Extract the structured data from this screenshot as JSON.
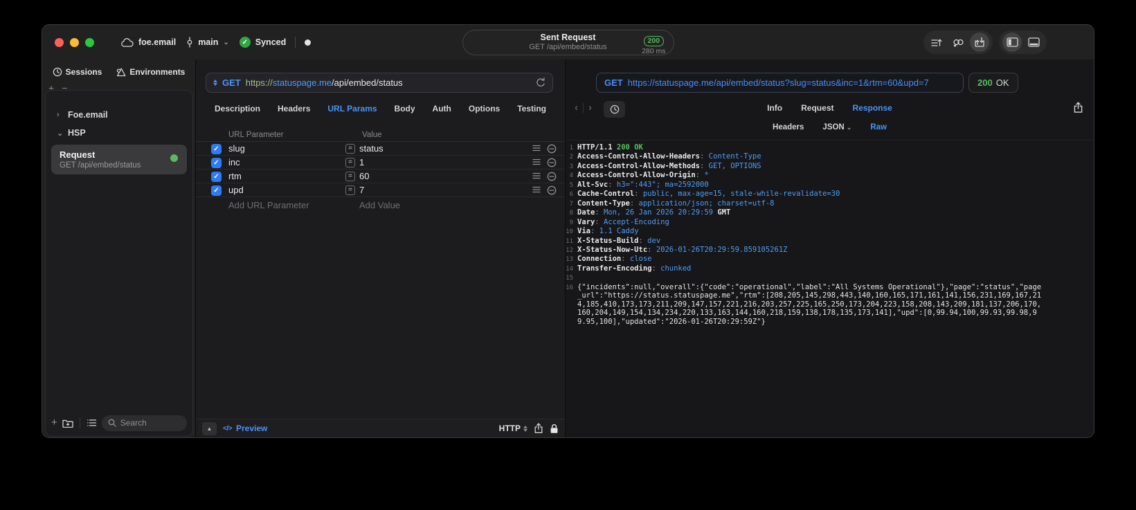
{
  "titlebar": {
    "project": "foe.email",
    "branch": "main",
    "sync_label": "Synced",
    "center": {
      "title": "Sent Request",
      "subtitle": "GET /api/embed/status",
      "status_code": "200",
      "duration": "280 ms"
    }
  },
  "sidebar": {
    "tabs": [
      {
        "label": "Sessions"
      },
      {
        "label": "Environments"
      }
    ],
    "tree": [
      {
        "label": "Foe.email"
      },
      {
        "label": "HSP"
      }
    ],
    "request_item": {
      "title": "Request",
      "subtitle": "GET /api/embed/status"
    },
    "search_placeholder": "Search"
  },
  "request_pane": {
    "method": "GET",
    "url": {
      "scheme": "https://",
      "host": "statuspage.me",
      "path": "/api/embed/status"
    },
    "tabs": [
      "Description",
      "Headers",
      "URL Params",
      "Body",
      "Auth",
      "Options",
      "Testing"
    ],
    "active_tab": "URL Params",
    "params": {
      "columns": [
        "URL Parameter",
        "Value"
      ],
      "rows": [
        {
          "name": "slug",
          "value": "status",
          "checked": true
        },
        {
          "name": "inc",
          "value": "1",
          "checked": true
        },
        {
          "name": "rtm",
          "value": "60",
          "checked": true
        },
        {
          "name": "upd",
          "value": "7",
          "checked": true
        }
      ],
      "add_name": "Add URL Parameter",
      "add_value": "Add Value"
    },
    "footer": {
      "preview": "Preview",
      "protocol": "HTTP"
    }
  },
  "response_pane": {
    "request_line": {
      "method": "GET",
      "url": "https://statuspage.me/api/embed/status?slug=status&inc=1&rtm=60&upd=7"
    },
    "status": {
      "code": "200",
      "text": "OK"
    },
    "tabs": [
      "Info",
      "Request",
      "Response"
    ],
    "active_tab": "Response",
    "view_tabs": [
      "Headers",
      "JSON",
      "Raw"
    ],
    "active_view": "Raw",
    "body_lines": [
      {
        "n": "1",
        "parts": [
          [
            "HTTP/1.1 ",
            "n"
          ],
          [
            "200 OK",
            "g"
          ]
        ]
      },
      {
        "n": "2",
        "parts": [
          [
            "Access-Control-Allow-Headers",
            "n"
          ],
          [
            ": ",
            "p"
          ],
          [
            "Content-Type",
            "v"
          ]
        ]
      },
      {
        "n": "3",
        "parts": [
          [
            "Access-Control-Allow-Methods",
            "n"
          ],
          [
            ": ",
            "p"
          ],
          [
            "GET, OPTIONS",
            "v"
          ]
        ]
      },
      {
        "n": "4",
        "parts": [
          [
            "Access-Control-Allow-Origin",
            "n"
          ],
          [
            ": ",
            "p"
          ],
          [
            "*",
            "v"
          ]
        ]
      },
      {
        "n": "5",
        "parts": [
          [
            "Alt-Svc",
            "n"
          ],
          [
            ": ",
            "p"
          ],
          [
            "h3=\":443\"; ma=2592000",
            "v"
          ]
        ]
      },
      {
        "n": "6",
        "parts": [
          [
            "Cache-Control",
            "n"
          ],
          [
            ": ",
            "p"
          ],
          [
            "public, max-age=15, stale-while-revalidate=30",
            "v"
          ]
        ]
      },
      {
        "n": "7",
        "parts": [
          [
            "Content-Type",
            "n"
          ],
          [
            ": ",
            "p"
          ],
          [
            "application/json; charset=utf-8",
            "v"
          ]
        ]
      },
      {
        "n": "8",
        "parts": [
          [
            "Date",
            "n"
          ],
          [
            ": ",
            "p"
          ],
          [
            "Mon, 26 Jan 2026 20:29:59 ",
            "v"
          ],
          [
            "GMT",
            "n"
          ]
        ]
      },
      {
        "n": "9",
        "parts": [
          [
            "Vary",
            "n"
          ],
          [
            ": ",
            "p"
          ],
          [
            "Accept-Encoding",
            "v"
          ]
        ]
      },
      {
        "n": "10",
        "parts": [
          [
            "Via",
            "n"
          ],
          [
            ": ",
            "p"
          ],
          [
            "1.1 Caddy",
            "v"
          ]
        ]
      },
      {
        "n": "11",
        "parts": [
          [
            "X-Status-Build",
            "n"
          ],
          [
            ": ",
            "p"
          ],
          [
            "dev",
            "v"
          ]
        ]
      },
      {
        "n": "12",
        "parts": [
          [
            "X-Status-Now-Utc",
            "n"
          ],
          [
            ": ",
            "p"
          ],
          [
            "2026-01-26T20:29:59.859105261Z",
            "v"
          ]
        ]
      },
      {
        "n": "13",
        "parts": [
          [
            "Connection",
            "n"
          ],
          [
            ": ",
            "p"
          ],
          [
            "close",
            "v"
          ]
        ]
      },
      {
        "n": "14",
        "parts": [
          [
            "Transfer-Encoding",
            "n"
          ],
          [
            ": ",
            "p"
          ],
          [
            "chunked",
            "v"
          ]
        ]
      },
      {
        "n": "15",
        "parts": []
      },
      {
        "n": "16",
        "parts": [
          [
            "{\"incidents\":null,\"overall\":{\"code\":\"operational\",\"label\":\"All Systems Operational\"},\"page\":\"status\",\"page_url\":\"https://status.statuspage.me\",\"rtm\":[208,205,145,298,443,140,160,165,171,161,141,156,231,169,167,214,185,410,173,173,211,209,147,157,221,216,203,257,225,165,250,173,204,223,158,208,143,209,181,137,206,170,160,204,149,154,134,234,220,133,163,144,160,218,159,138,178,135,173,141],\"upd\":[0,99.94,100,99.93,99.98,99.95,100],\"updated\":\"2026-01-26T20:29:59Z\"}",
            "j"
          ]
        ]
      }
    ]
  },
  "glyphs": {
    "check": "✓",
    "chevron_down": "⌄",
    "chevron_right": "›",
    "back": "‹",
    "forward": "›",
    "plus": "+",
    "minus": "−",
    "equals": "=",
    "code": "</>",
    "panel_up": "▲"
  },
  "colors": {
    "accent_blue": "#4b93f7",
    "status_green": "#58bd5c",
    "url_scheme_green": "#a3c386",
    "checkbox_blue": "#2e7bf3"
  }
}
